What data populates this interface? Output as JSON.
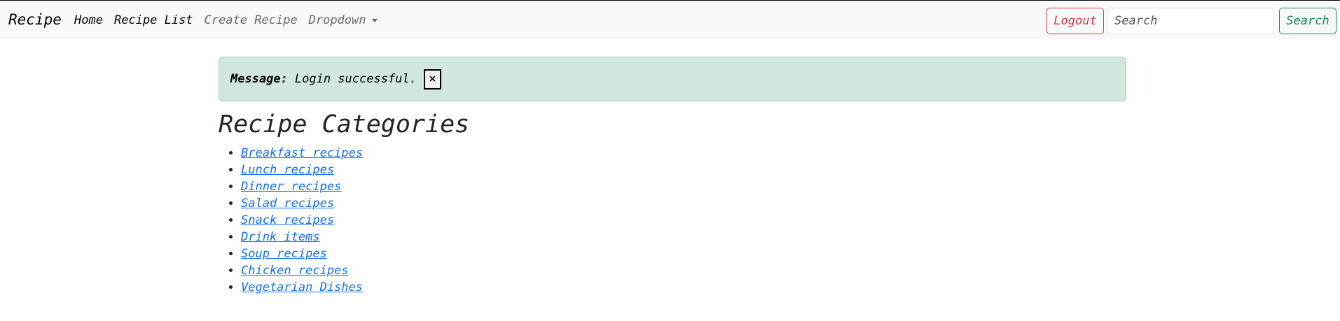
{
  "navbar": {
    "brand": "Recipe",
    "links": [
      {
        "label": "Home"
      },
      {
        "label": "Recipe List"
      },
      {
        "label": "Create Recipe"
      },
      {
        "label": "Dropdown"
      }
    ],
    "logout_label": "Logout",
    "search_placeholder": "Search",
    "search_button_label": "Search"
  },
  "alert": {
    "label": "Message:",
    "text": "Login successful.",
    "close_label": "×"
  },
  "page_title": "Recipe Categories",
  "categories": [
    {
      "label": "Breakfast recipes"
    },
    {
      "label": "Lunch recipes"
    },
    {
      "label": "Dinner recipes"
    },
    {
      "label": "Salad recipes"
    },
    {
      "label": "Snack recipes"
    },
    {
      "label": "Drink items"
    },
    {
      "label": "Soup recipes"
    },
    {
      "label": "Chicken recipes"
    },
    {
      "label": "Vegetarian Dishes"
    }
  ],
  "colors": {
    "navbar_bg": "#f8f9fa",
    "alert_bg": "#d1e7dd",
    "link": "#0d6efd",
    "logout": "#dc3545",
    "search": "#198754"
  }
}
